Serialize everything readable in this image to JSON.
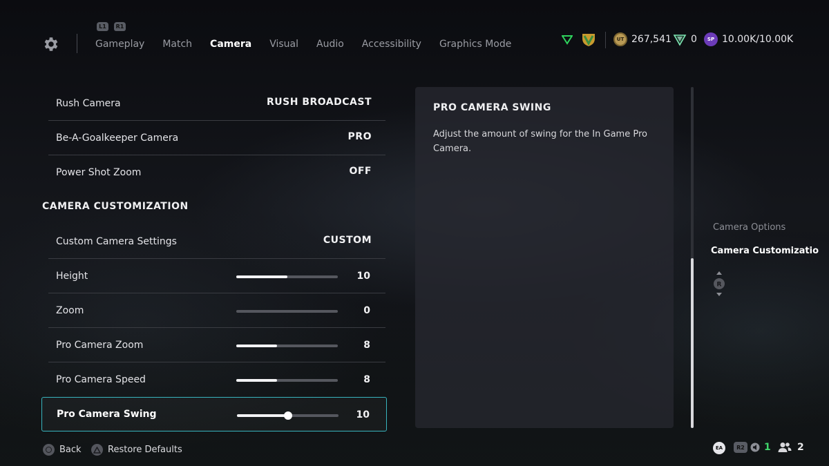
{
  "nav": {
    "shoulder_left": "L1",
    "shoulder_right": "R1",
    "tabs": [
      {
        "label": "Gameplay",
        "active": false
      },
      {
        "label": "Match",
        "active": false
      },
      {
        "label": "Camera",
        "active": true
      },
      {
        "label": "Visual",
        "active": false
      },
      {
        "label": "Audio",
        "active": false
      },
      {
        "label": "Accessibility",
        "active": false
      },
      {
        "label": "Graphics Mode",
        "active": false
      }
    ]
  },
  "currencies": {
    "coins_badge": "UT",
    "coins": "267,541",
    "points": "0",
    "sp_badge": "SP",
    "sp": "10.00K/10.00K"
  },
  "settings": {
    "rows": [
      {
        "label": "Rush Camera",
        "value": "RUSH BROADCAST"
      },
      {
        "label": "Be-A-Goalkeeper Camera",
        "value": "PRO"
      },
      {
        "label": "Power Shot Zoom",
        "value": "OFF"
      }
    ],
    "section_title": "CAMERA CUSTOMIZATION",
    "custom_row": {
      "label": "Custom Camera Settings",
      "value": "CUSTOM"
    },
    "sliders": [
      {
        "label": "Height",
        "value": "10",
        "level": 0.5
      },
      {
        "label": "Zoom",
        "value": "0",
        "level": 0.0
      },
      {
        "label": "Pro Camera Zoom",
        "value": "8",
        "level": 0.4
      },
      {
        "label": "Pro Camera Speed",
        "value": "8",
        "level": 0.4
      },
      {
        "label": "Pro Camera Swing",
        "value": "10",
        "level": 0.5
      }
    ]
  },
  "panel": {
    "title": "PRO CAMERA SWING",
    "description": "Adjust the amount of swing for the In Game Pro Camera."
  },
  "jump_list": {
    "item1": "Camera Options",
    "item2": "Camera Customizatio",
    "stick": "R"
  },
  "footer": {
    "back": "Back",
    "restore": "Restore Defaults",
    "ea": "EA",
    "r2": "R2",
    "voice_count": "1",
    "friends_count": "2"
  },
  "colors": {
    "accent_selected_border": "#38b5bf",
    "voice_count_green": "#3fd46a"
  }
}
